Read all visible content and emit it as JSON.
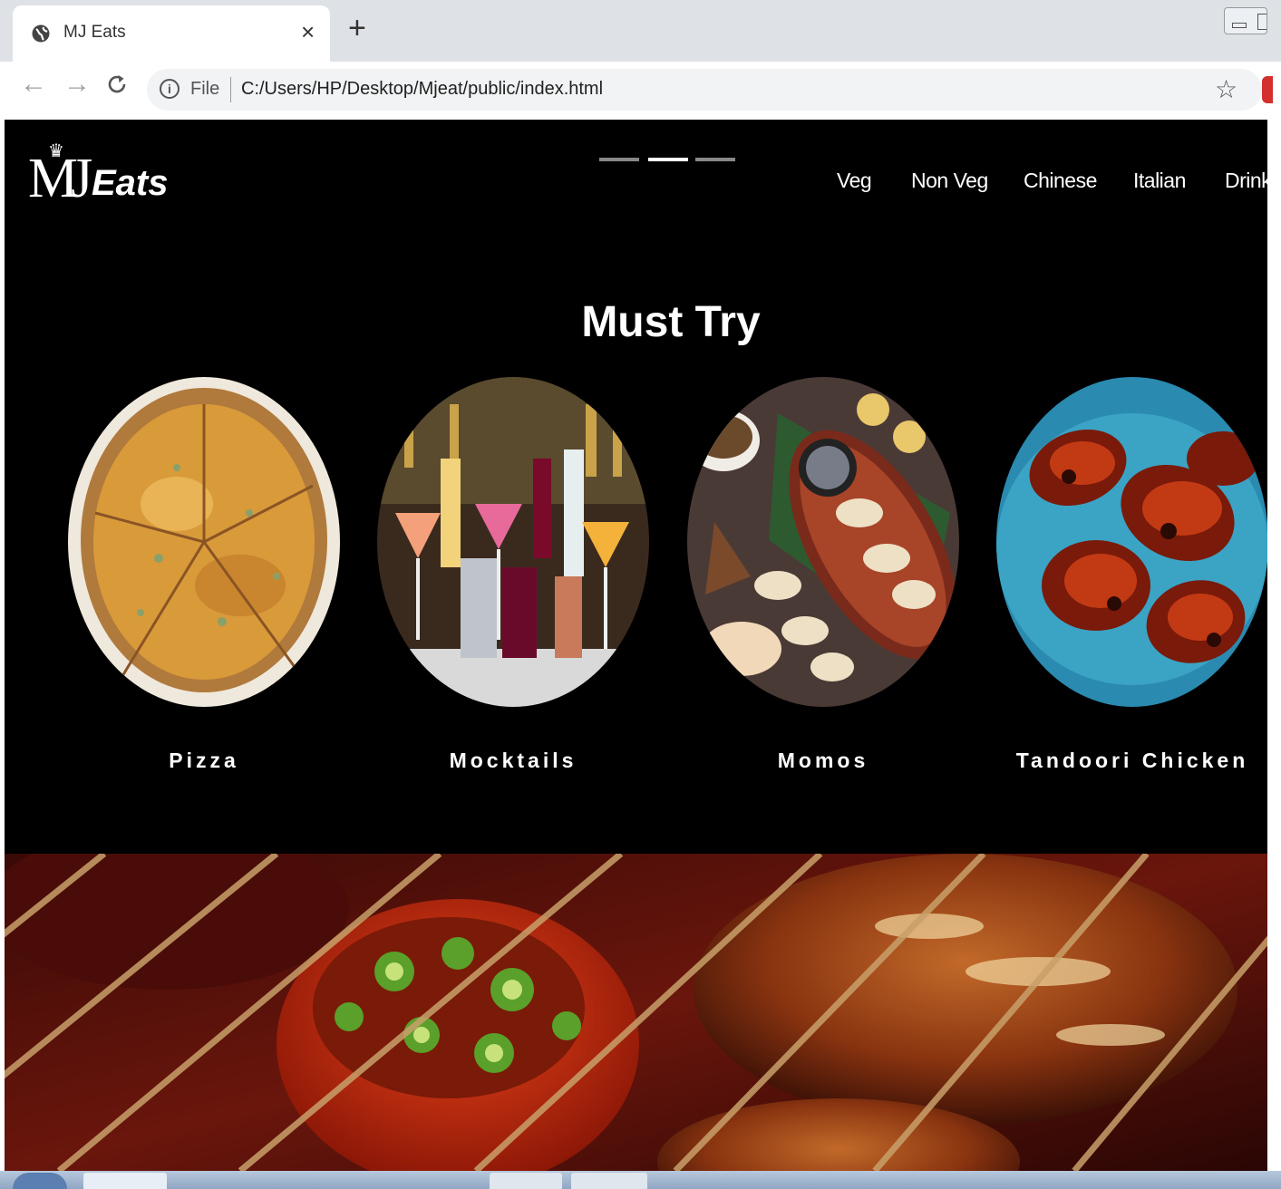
{
  "browser": {
    "tab_title": "MJ Eats",
    "tab_close": "×",
    "new_tab": "+",
    "file_label": "File",
    "url": "C:/Users/HP/Desktop/Mjeat/public/index.html"
  },
  "site": {
    "logo_monogram": "MJ",
    "logo_word": "Eats",
    "slider": {
      "count": 3,
      "active_index": 1
    },
    "nav": [
      "Veg",
      "Non Veg",
      "Chinese",
      "Italian",
      "Drinks"
    ],
    "section_title": "Must Try",
    "dishes": [
      {
        "name": "Pizza",
        "icon": "pizza-photo"
      },
      {
        "name": "Mocktails",
        "icon": "mocktails-photo"
      },
      {
        "name": "Momos",
        "icon": "momos-photo"
      },
      {
        "name": "Tandoori Chicken",
        "icon": "tandoori-chicken-photo"
      }
    ],
    "hero_icon": "grilled-food-photo"
  },
  "colors": {
    "page_bg": "#000000",
    "text": "#ffffff",
    "chrome_bg": "#dee1e6",
    "omnibox_bg": "#f1f3f4"
  }
}
